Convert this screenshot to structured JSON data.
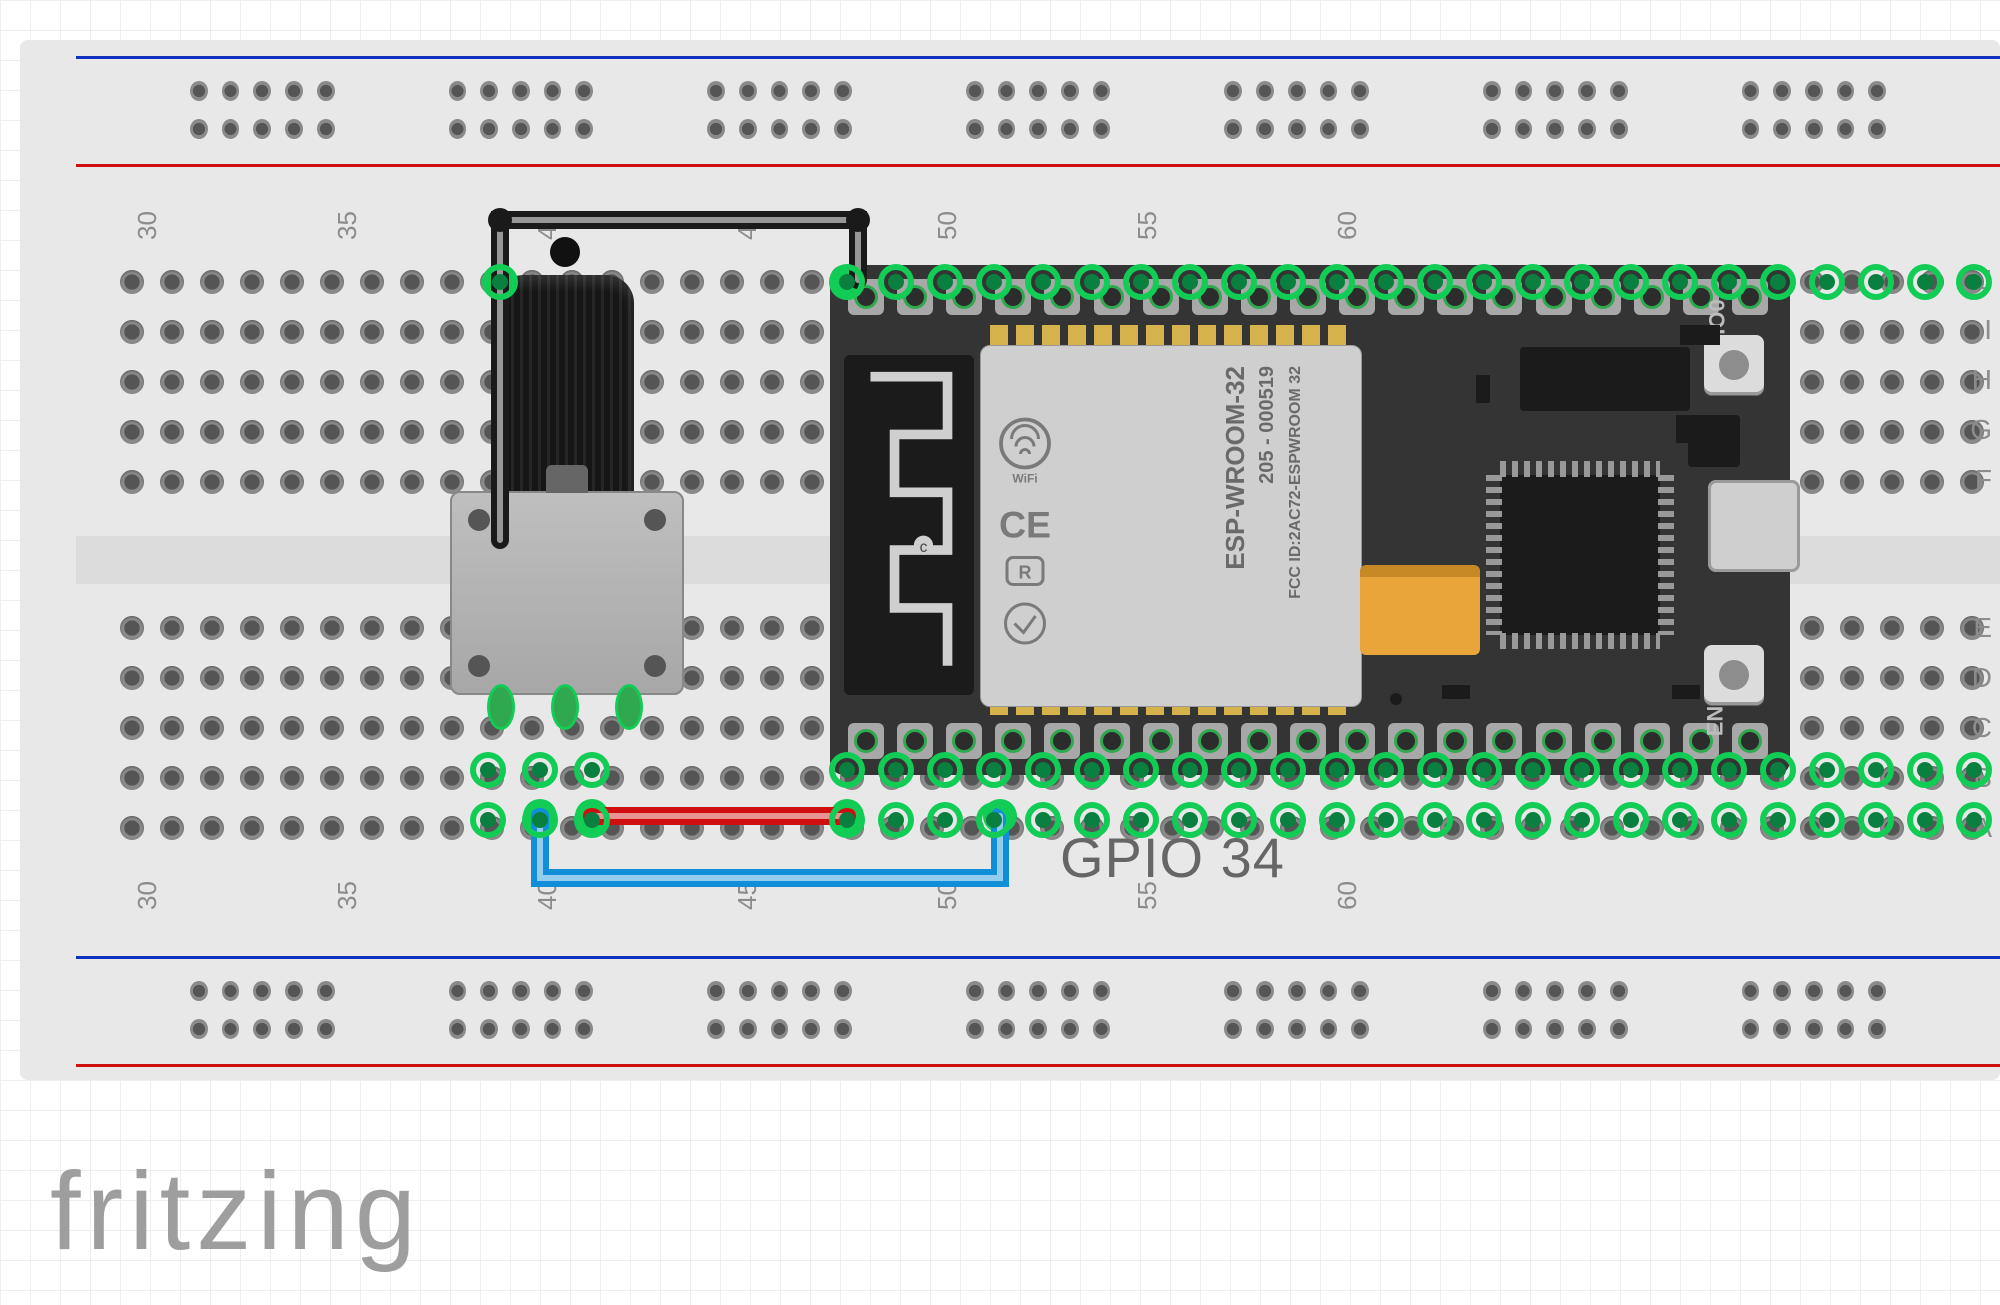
{
  "diagram": {
    "tool": "fritzing",
    "label": "GPIO 34"
  },
  "breadboard": {
    "column_numbers": [
      30,
      35,
      40,
      45,
      50,
      55,
      60
    ],
    "row_letters_top": [
      "J",
      "I",
      "H",
      "G",
      "F"
    ],
    "row_letters_bot": [
      "E",
      "D",
      "C",
      "B",
      "A"
    ]
  },
  "components": {
    "esp32": {
      "module_text": "ESP-WROOM-32",
      "serial_text": "205 - 000519",
      "fcc_text": "FCC ID:2AC72-ESPWROOM 32",
      "marks": [
        "WiFi",
        "CE",
        "R"
      ],
      "btn_boot": "IO0",
      "btn_en": "EN",
      "pin_count_per_side": 19
    },
    "potentiometer": {
      "legs": 3
    },
    "wires": [
      {
        "name": "gnd-wire",
        "color": "#1a1a1a",
        "desc": "pot top-left to ESP32 first top pin (GND)"
      },
      {
        "name": "vin-wire",
        "color": "#d01010",
        "desc": "pot right leg to ESP32 VIN (first bottom pin)"
      },
      {
        "name": "signal-wire",
        "color": "#118ed8",
        "desc": "pot middle leg to ESP32 GPIO34"
      }
    ]
  }
}
